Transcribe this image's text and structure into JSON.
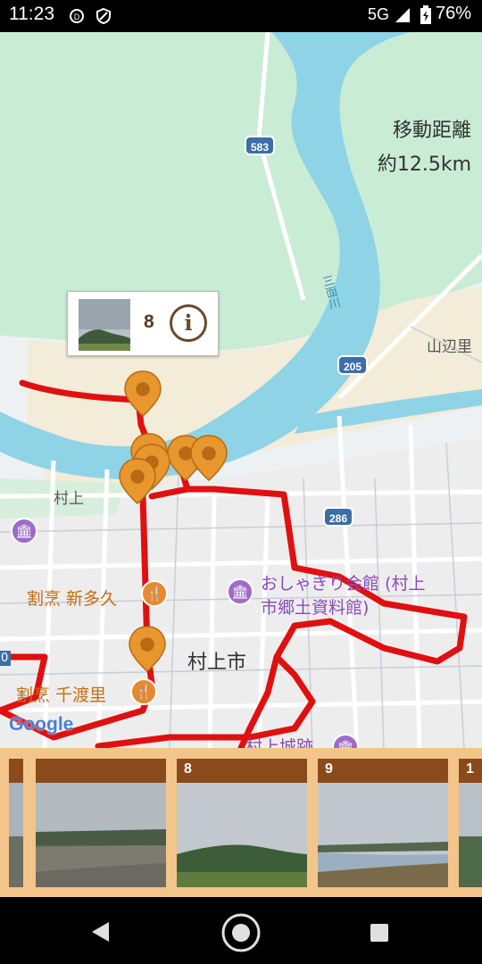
{
  "status_bar": {
    "time": "11:23",
    "network": "5G",
    "battery": "76%",
    "icons": [
      "data-saver-icon",
      "shield-icon",
      "signal-icon",
      "battery-icon"
    ]
  },
  "map": {
    "distance_title": "移動距離",
    "distance_value": "約12.5km",
    "route_color": "#e01010",
    "marker_color": "#e8962e",
    "water_color": "#8fd3e6",
    "green_color": "#c9ecd5",
    "labels": {
      "place_murakami": "村上",
      "yamabe": "山辺里",
      "murakami_city": "村上市",
      "museum": "おしゃぎり会館 (村上",
      "museum_line2": "市郷土資料館)",
      "restaurant1": "割烹 新多久",
      "restaurant2": "割烹 千渡里",
      "castle": "村上城跡",
      "river_name": "三面川",
      "left_edge": "0",
      "google": "Google"
    },
    "roads": [
      "583",
      "205",
      "286"
    ],
    "popup": {
      "number": "8",
      "info_icon": "i"
    }
  },
  "photo_strip": {
    "cards": [
      {
        "caption": ""
      },
      {
        "caption": ""
      },
      {
        "caption": "8"
      },
      {
        "caption": "9"
      },
      {
        "caption": "1"
      }
    ]
  },
  "nav_bar": {
    "buttons": [
      "back-icon",
      "home-icon",
      "recents-icon"
    ]
  }
}
